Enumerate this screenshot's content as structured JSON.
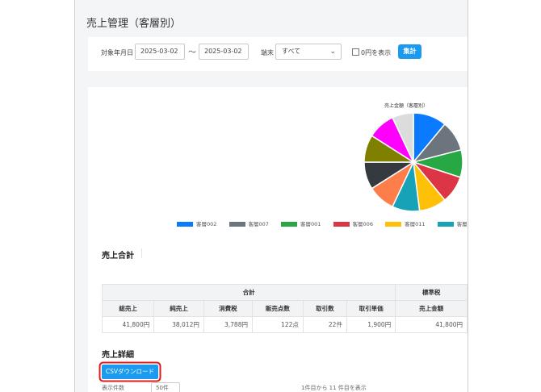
{
  "page_title": "売上管理（客層別）",
  "filter": {
    "period_label": "対象年月日",
    "date_from": "2025-03-02",
    "tilde": "～",
    "date_to": "2025-03-02",
    "terminal_label": "端末",
    "terminal_value": "すべて",
    "zero_yen_label": "0円を表示",
    "aggregate_button": "集計"
  },
  "chart": {
    "title": "売上金額（客層別）"
  },
  "chart_data": {
    "type": "pie",
    "title": "売上金額（客層別）",
    "slices": [
      {
        "label": "客層002",
        "value": 11,
        "color": "#0a7bff"
      },
      {
        "label": "客層007",
        "value": 10,
        "color": "#6c757d"
      },
      {
        "label": "客層001",
        "value": 9,
        "color": "#28a745"
      },
      {
        "label": "客層006",
        "value": 9,
        "color": "#dc3545"
      },
      {
        "label": "客層011",
        "value": 9,
        "color": "#ffc107"
      },
      {
        "label": "客層003",
        "value": 9,
        "color": "#17a2b8"
      },
      {
        "label": "客層",
        "value": 9,
        "color": "#fd7e4a"
      },
      {
        "label": "",
        "value": 9,
        "color": "#343a40"
      },
      {
        "label": "",
        "value": 9,
        "color": "#808000"
      },
      {
        "label": "",
        "value": 9,
        "color": "#ff00ff"
      },
      {
        "label": "",
        "value": 7,
        "color": "#dcdcdc"
      }
    ],
    "legend_position": "bottom"
  },
  "legend": [
    {
      "label": "客層002",
      "color": "#0a7bff"
    },
    {
      "label": "客層007",
      "color": "#6c757d"
    },
    {
      "label": "客層001",
      "color": "#28a745"
    },
    {
      "label": "客層006",
      "color": "#dc3545"
    },
    {
      "label": "客層011",
      "color": "#ffc107"
    },
    {
      "label": "客層003",
      "color": "#17a2b8"
    },
    {
      "label": "客層",
      "color": "#fd7e4a"
    }
  ],
  "totals": {
    "section_title": "売上合計",
    "group_total": "合計",
    "group_standard": "標準税",
    "headers": [
      "総売上",
      "純売上",
      "消費税",
      "販売点数",
      "取引数",
      "取引単価",
      "売上金額"
    ],
    "row": [
      "41,800円",
      "38,012円",
      "3,788円",
      "122点",
      "22件",
      "1,900円",
      "41,800円"
    ]
  },
  "details": {
    "section_title": "売上詳細",
    "csv_button": "CSVダウンロード",
    "display_count_label": "表示件数",
    "display_count_value": "50件",
    "range_text": "1件目から 11 件目を表示"
  },
  "colors": {
    "accent": "#1a9bef",
    "highlight_outline": "#e21a1a"
  }
}
